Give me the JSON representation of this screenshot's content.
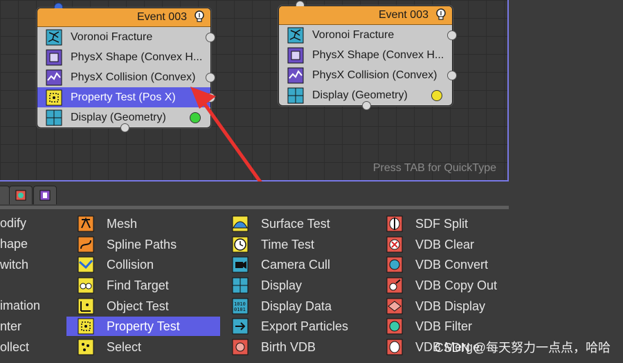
{
  "graph": {
    "hint": "Press TAB for QuickType"
  },
  "nodes": [
    {
      "title": "Event 003",
      "operators": [
        {
          "label": "Voronoi Fracture",
          "icon": "voronoi-icon"
        },
        {
          "label": "PhysX Shape (Convex H...",
          "icon": "physx-shape-icon"
        },
        {
          "label": "PhysX Collision (Convex)",
          "icon": "physx-collision-icon"
        },
        {
          "label": "Property Test (Pos X)",
          "icon": "property-test-icon",
          "selected": true
        },
        {
          "label": "Display (Geometry)",
          "icon": "display-icon",
          "dot": "#3bd13b"
        }
      ]
    },
    {
      "title": "Event 003",
      "operators": [
        {
          "label": "Voronoi Fracture",
          "icon": "voronoi-icon"
        },
        {
          "label": "PhysX Shape (Convex H...",
          "icon": "physx-shape-icon"
        },
        {
          "label": "PhysX Collision (Convex)",
          "icon": "physx-collision-icon"
        },
        {
          "label": "Display (Geometry)",
          "icon": "display-icon",
          "dot": "#f0e02a"
        }
      ]
    }
  ],
  "depot": {
    "col0": [
      "odify",
      "hape",
      "witch",
      "imation",
      "nter",
      "ollect"
    ],
    "col1": [
      "Mesh",
      "Spline Paths",
      "Collision",
      "Find Target",
      "Object Test",
      "Property Test",
      "Select"
    ],
    "col2": [
      "Surface Test",
      "Time Test",
      "Camera Cull",
      "Display",
      "Display Data",
      "Export Particles",
      "Birth VDB"
    ],
    "col3": [
      "SDF Split",
      "VDB Clear",
      "VDB Convert",
      "VDB Copy Out",
      "VDB Display",
      "VDB Filter",
      "VDB Merge"
    ]
  },
  "watermark": "CSDN @每天努力一点点，哈哈",
  "colors": {
    "accent": "#5d5de3",
    "node_header": "#f0a23a",
    "arrow": "#e8322e"
  }
}
